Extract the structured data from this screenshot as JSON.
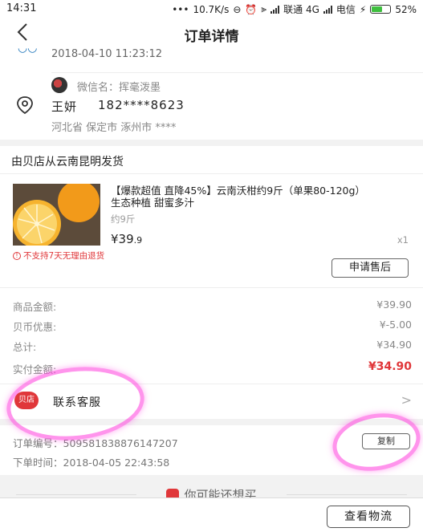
{
  "status_bar": {
    "time": "14:31",
    "dots": "•••",
    "speed": "10.7K/s",
    "carrier1": "联通 4G",
    "carrier2": "电信",
    "battery": "52%",
    "battery_level": 0.52
  },
  "nav": {
    "title": "订单详情",
    "back_icon": "chevron-left-icon"
  },
  "address": {
    "timestamp": "2018-04-10 11:23:12",
    "wechat_name": "微信名：挥毫泼墨",
    "recipient_name": "王妍",
    "phone": "182****8623",
    "region": "河北省 保定市 涿州市 ****"
  },
  "shop": {
    "ship_from": "由贝店从云南昆明发货",
    "product": {
      "title": "【爆款超值 直降45%】云南沃柑约9斤（单果80-120g）生态种植 甜蜜多汁",
      "spec": "约9斤",
      "price_main": "¥39",
      "price_decimal": ".9",
      "quantity": "x1",
      "no_return_notice": "不支持7天无理由退货",
      "after_sale_button": "申请售后"
    },
    "summary": [
      {
        "label": "商品金额:",
        "value": "¥39.90"
      },
      {
        "label": "贝币优惠:",
        "value": "¥-5.00"
      },
      {
        "label": "总计:",
        "value": "¥34.90"
      }
    ],
    "actual_paid": {
      "label": "实付金额:",
      "value": "¥34.90"
    },
    "customer_service": {
      "logo": "贝店",
      "label": "联系客服"
    }
  },
  "order": {
    "number": "订单编号：5095818388761472​07",
    "number_clean": "订单编号：509581838876147207",
    "copy_button": "复制",
    "order_time": "下单时间：2018-04-05 22:43:58"
  },
  "recommend": {
    "title": "你可能还想买"
  },
  "bottom": {
    "logistics_button": "查看物流"
  },
  "colors": {
    "accent_red": "#e0373a",
    "highlight_pink": "#ff3cdc"
  }
}
